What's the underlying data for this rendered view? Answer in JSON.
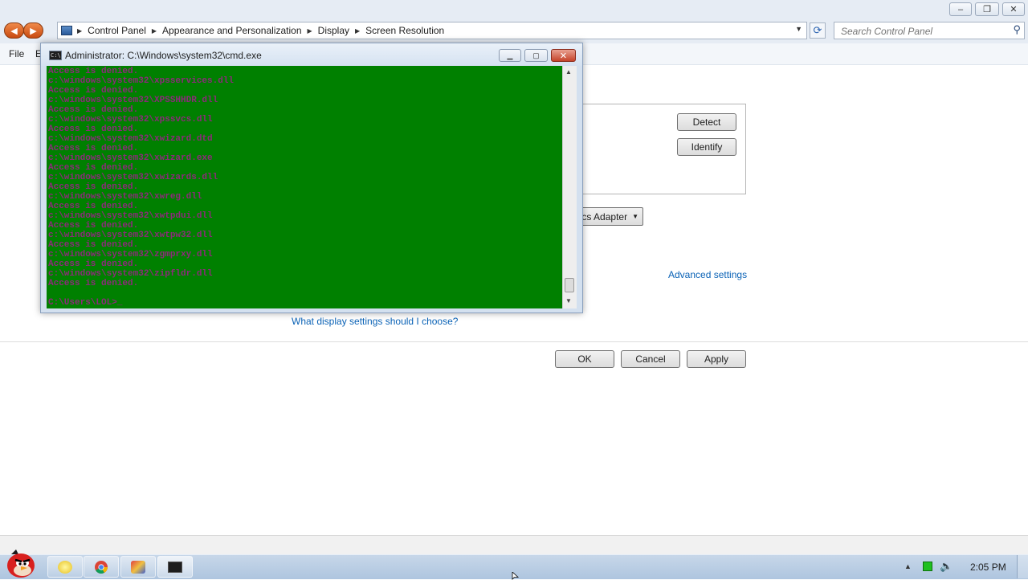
{
  "control_panel": {
    "breadcrumbs": [
      "Control Panel",
      "Appearance and Personalization",
      "Display",
      "Screen Resolution"
    ],
    "search_placeholder": "Search Control Panel",
    "menu": {
      "file": "File",
      "edit_partial": "E"
    },
    "caption_buttons": {
      "minimize": "–",
      "maximize": "❐",
      "close": "✕"
    },
    "detect_label": "Detect",
    "identify_label": "Identify",
    "adapter_partial": "cs Adapter",
    "advanced_settings": "Advanced settings",
    "help_link": "What display settings should I choose?",
    "ok_label": "OK",
    "cancel_label": "Cancel",
    "apply_label": "Apply"
  },
  "cmd": {
    "title": "Administrator: C:\\Windows\\system32\\cmd.exe",
    "icon_text": "C:\\",
    "caption_buttons": {
      "minimize": "▁",
      "maximize": "▢",
      "close": "✕"
    },
    "lines": [
      "Access is denied.",
      "c:\\windows\\system32\\xpsservices.dll",
      "Access is denied.",
      "c:\\windows\\system32\\XPSSHHDR.dll",
      "Access is denied.",
      "c:\\windows\\system32\\xpssvcs.dll",
      "Access is denied.",
      "c:\\windows\\system32\\xwizard.dtd",
      "Access is denied.",
      "c:\\windows\\system32\\xwizard.exe",
      "Access is denied.",
      "c:\\windows\\system32\\xwizards.dll",
      "Access is denied.",
      "c:\\windows\\system32\\xwreg.dll",
      "Access is denied.",
      "c:\\windows\\system32\\xwtpdui.dll",
      "Access is denied.",
      "c:\\windows\\system32\\xwtpw32.dll",
      "Access is denied.",
      "c:\\windows\\system32\\zgmprxy.dll",
      "Access is denied.",
      "c:\\windows\\system32\\zipfldr.dll",
      "Access is denied.",
      "",
      "C:\\Users\\LOL>_"
    ]
  },
  "taskbar": {
    "time": "2:05 PM",
    "icons": [
      "start-orb-angry-bird-icon",
      "explorer-icon",
      "chrome-icon",
      "paint-icon",
      "cmd-icon"
    ]
  },
  "colors": {
    "console_bg": "#008000",
    "console_text": "#8c2a7a",
    "link": "#0a62b6",
    "cmd_close": "#c5432a"
  }
}
